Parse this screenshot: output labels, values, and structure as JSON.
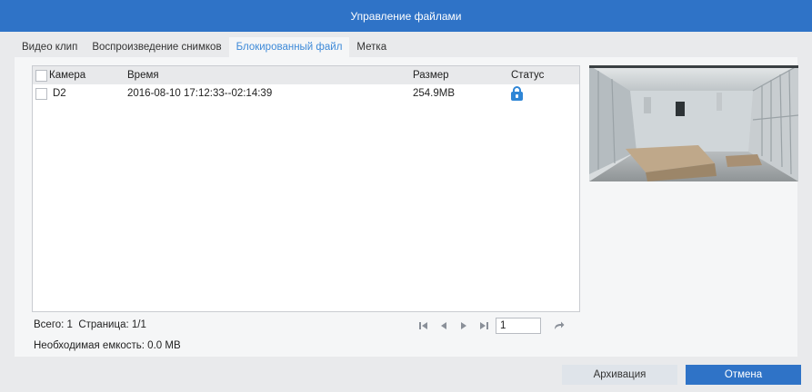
{
  "window": {
    "title": "Управление файлами"
  },
  "tabs": [
    {
      "label": "Видео клип",
      "active": false
    },
    {
      "label": "Воспроизведение снимков",
      "active": false
    },
    {
      "label": "Блокированный файл",
      "active": true
    },
    {
      "label": "Метка",
      "active": false
    }
  ],
  "table": {
    "headers": {
      "camera": "Камера",
      "time": "Время",
      "size": "Размер",
      "status": "Статус"
    },
    "rows": [
      {
        "camera": "D2",
        "time": "2016-08-10 17:12:33--02:14:39",
        "size": "254.9MB",
        "status_icon": "lock-icon",
        "checked": false
      }
    ]
  },
  "summary": {
    "total": "Всего: 1",
    "page": "Страница: 1/1",
    "required_capacity": "Необходимая емкость: 0.0 MB"
  },
  "pagination": {
    "page_input": "1"
  },
  "buttons": {
    "archive": "Архивация",
    "cancel": "Отмена"
  },
  "colors": {
    "titlebar": "#2f73c7",
    "active_tab": "#3e8ad8",
    "lock": "#2f86d6",
    "cancel_button": "#2f73c7"
  }
}
